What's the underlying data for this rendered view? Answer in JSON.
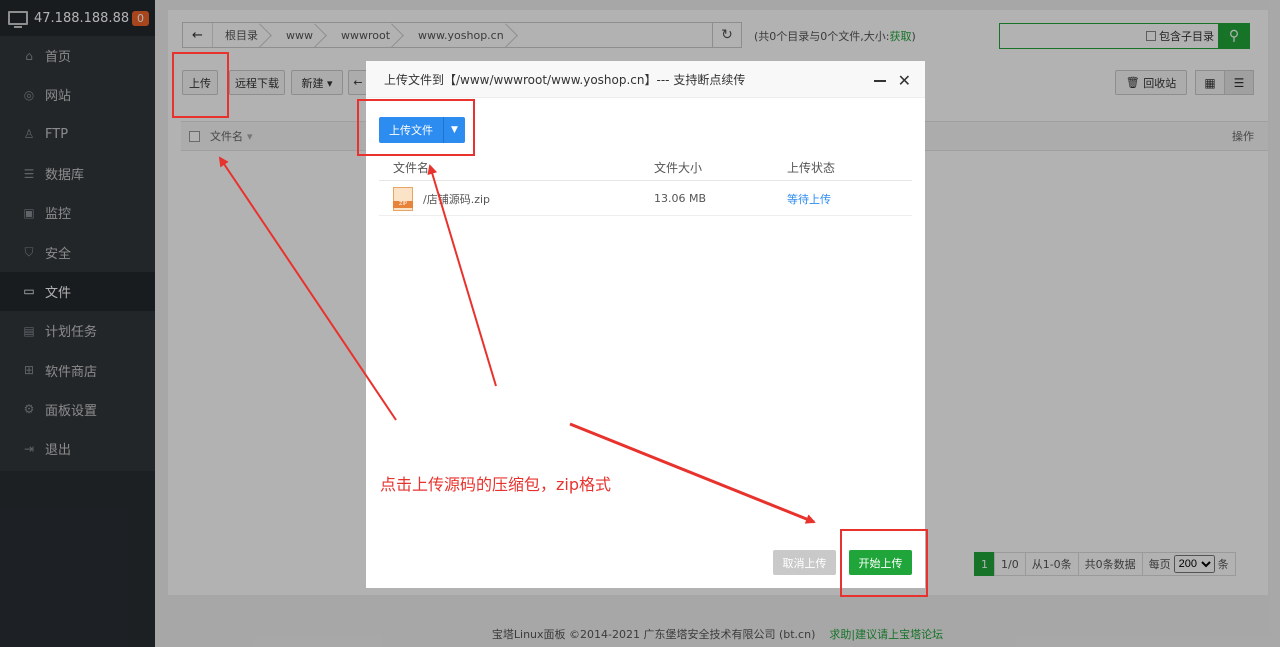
{
  "sidebar": {
    "ip": "47.188.188.88",
    "badge": "0",
    "items": [
      {
        "label": "首页",
        "icon": "home-icon",
        "glyph": "⌂"
      },
      {
        "label": "网站",
        "icon": "globe-icon",
        "glyph": "◎"
      },
      {
        "label": "FTP",
        "icon": "user-icon",
        "glyph": "♙"
      },
      {
        "label": "数据库",
        "icon": "database-icon",
        "glyph": "☰"
      },
      {
        "label": "监控",
        "icon": "monitor-icon",
        "glyph": "▣"
      },
      {
        "label": "安全",
        "icon": "shield-icon",
        "glyph": "⛉"
      },
      {
        "label": "文件",
        "icon": "folder-icon",
        "glyph": "▭"
      },
      {
        "label": "计划任务",
        "icon": "calendar-icon",
        "glyph": "▤"
      },
      {
        "label": "软件商店",
        "icon": "apps-icon",
        "glyph": "⊞"
      },
      {
        "label": "面板设置",
        "icon": "gear-icon",
        "glyph": "⚙"
      },
      {
        "label": "退出",
        "icon": "logout-icon",
        "glyph": "⇥"
      }
    ]
  },
  "breadcrumb": [
    "根目录",
    "www",
    "wwwroot",
    "www.yoshop.cn"
  ],
  "fileinfo": {
    "text": "(共0个目录与0个文件,大小:",
    "get": "获取",
    "close": ")"
  },
  "search": {
    "include_sub": "包含子目录"
  },
  "toolbar": {
    "upload": "上传",
    "remote": "远程下载",
    "new": "新建 ▾",
    "recycle": "回收站"
  },
  "table": {
    "filename": "文件名",
    "operation": "操作"
  },
  "pager": {
    "current": "1",
    "pages": "1/0",
    "range": "从1-0条",
    "total": "共0条数据",
    "per_page_label": "每页",
    "per_page": "200",
    "unit": "条"
  },
  "footer": {
    "copyright": "宝塔Linux面板 ©2014-2021 广东堡塔安全技术有限公司 (bt.cn)",
    "link": "求助|建议请上宝塔论坛"
  },
  "modal": {
    "title": "上传文件到【/www/wwwroot/www.yoshop.cn】--- 支持断点续传",
    "upload_button": "上传文件",
    "columns": {
      "name": "文件名",
      "size": "文件大小",
      "status": "上传状态"
    },
    "files": [
      {
        "name": "/店铺源码.zip",
        "size": "13.06 MB",
        "status": "等待上传"
      }
    ],
    "cancel": "取消上传",
    "start": "开始上传"
  },
  "annotation": "点击上传源码的压缩包，zip格式",
  "colors": {
    "accent": "#20a53a",
    "blue": "#2d8cf0",
    "annotation": "#e8322d",
    "sidebar": "#32373c"
  }
}
